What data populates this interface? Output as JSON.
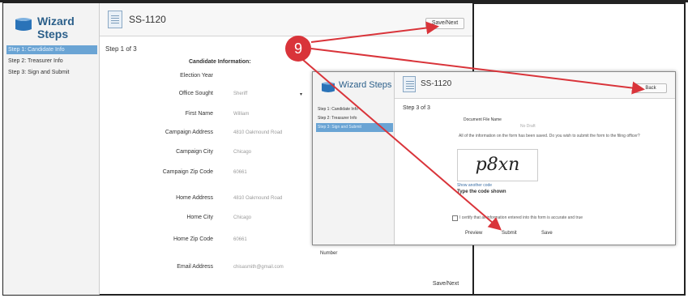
{
  "main": {
    "app_title": "Wizard Steps",
    "form_code": "SS-1120",
    "sidebar_items": [
      "Step 1: Candidate Info",
      "Step 2: Treasurer Info",
      "Step 3: Sign and Submit"
    ],
    "header_button": "Save/Next",
    "step_indicator": "Step 1 of 3",
    "section_title": "Candidate Information:",
    "fields": [
      {
        "label": "Election Year",
        "value": ""
      },
      {
        "label": "Office Sought",
        "value": "Sheriff"
      },
      {
        "label": "First Name",
        "value": "William"
      },
      {
        "label": "Campaign Address",
        "value": "4810 Oakmound Road"
      },
      {
        "label": "Campaign City",
        "value": "Chicago"
      },
      {
        "label": "Campaign Zip Code",
        "value": "60661"
      },
      {
        "label": "Home Address",
        "value": "4810 Oakmound Road"
      },
      {
        "label": "Home City",
        "value": "Chicago"
      },
      {
        "label": "Home Zip Code",
        "value": "60661"
      },
      {
        "label": "Email Address",
        "value": "chisasmith@gmail.com"
      }
    ],
    "partial_label": "Number",
    "footer_button": "Save/Next"
  },
  "overlay": {
    "app_title": "Wizard Steps",
    "form_code": "SS-1120",
    "sidebar_items": [
      "Step 1: Candidate Info",
      "Step 2: Treasurer Info",
      "Step 3: Sign and Submit"
    ],
    "header_button": "Back",
    "step_indicator": "Step 3 of 3",
    "document_file_name_label": "Document File Name",
    "document_file_name_value": "No Draft",
    "confirm_text": "All of the information on the form has been saved. Do you wish to submit the form to the filing officer?",
    "captcha_text": "p8xn",
    "captcha_link": "Show another code",
    "captcha_prompt": "Type the code shown",
    "certify_text": "I certify that all information entered into this form is accurate and true",
    "buttons": {
      "preview": "Preview",
      "submit": "Submit",
      "save": "Save"
    }
  },
  "annotation": {
    "callout_number": "9",
    "color": "#d9343a"
  }
}
